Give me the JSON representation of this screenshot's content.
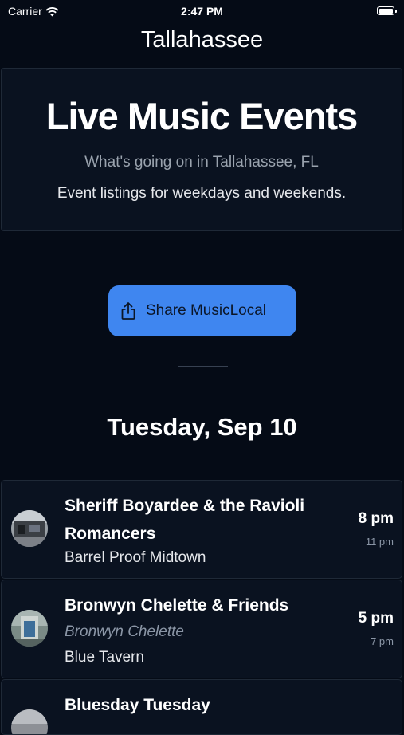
{
  "status_bar": {
    "carrier": "Carrier",
    "time": "2:47 PM"
  },
  "nav": {
    "title": "Tallahassee"
  },
  "hero": {
    "title": "Live Music Events",
    "subtitle": "What's going on in Tallahassee, FL",
    "description": "Event listings for weekdays and weekends."
  },
  "share": {
    "label": "Share MusicLocal",
    "icon": "share-icon"
  },
  "day": {
    "heading": "Tuesday, Sep 10"
  },
  "events": [
    {
      "title": "Sheriff Boyardee & the Ravioli Romancers",
      "artist": "",
      "venue": "Barrel Proof Midtown",
      "start": "8 pm",
      "end": "11 pm"
    },
    {
      "title": "Bronwyn Chelette & Friends",
      "artist": "Bronwyn Chelette",
      "venue": "Blue Tavern",
      "start": "5 pm",
      "end": "7 pm"
    },
    {
      "title": "Bluesday Tuesday",
      "artist": "",
      "venue": "",
      "start": "",
      "end": ""
    }
  ],
  "colors": {
    "background": "#050b16",
    "card": "#0a1220",
    "accent": "#3f86f0",
    "muted": "#8b96a6"
  }
}
